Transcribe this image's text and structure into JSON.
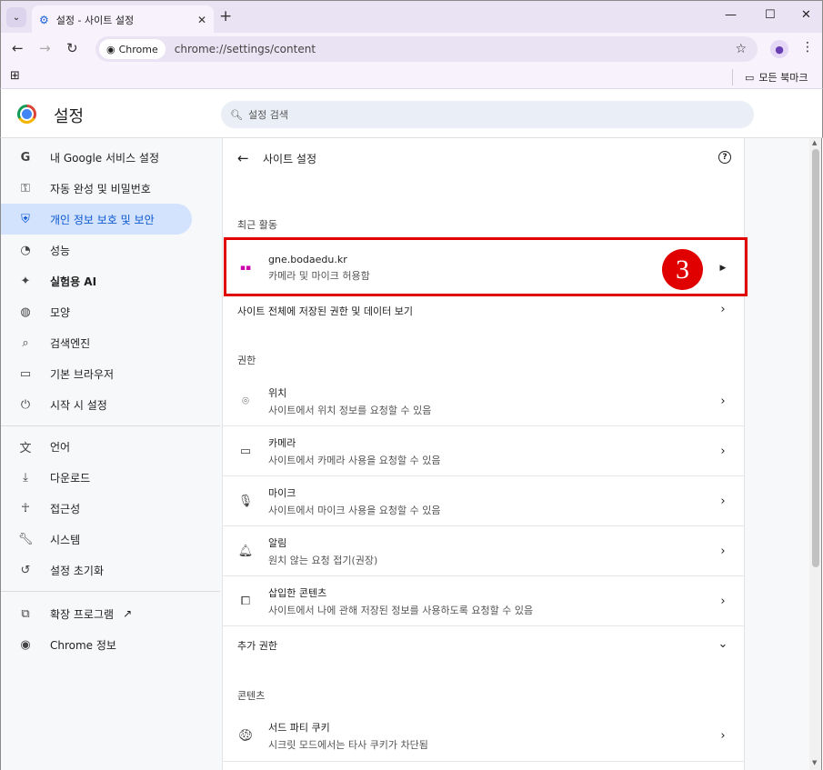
{
  "browser": {
    "tab_title": "설정 - 사이트 설정",
    "chip_label": "Chrome",
    "url": "chrome://settings/content",
    "bookmarks_all": "모든 북마크"
  },
  "header": {
    "title": "설정",
    "search_placeholder": "설정 검색"
  },
  "sidebar": {
    "items": [
      {
        "icon": "google-g-icon",
        "label": "내 Google 서비스 설정"
      },
      {
        "icon": "key-icon",
        "label": "자동 완성 및 비밀번호"
      },
      {
        "icon": "shield-icon",
        "label": "개인 정보 보호 및 보안"
      },
      {
        "icon": "speedometer-icon",
        "label": "성능"
      },
      {
        "icon": "sparkle-icon",
        "label": "실험용 AI"
      },
      {
        "icon": "palette-icon",
        "label": "모양"
      },
      {
        "icon": "search-icon",
        "label": "검색엔진"
      },
      {
        "icon": "browser-window-icon",
        "label": "기본 브라우저"
      },
      {
        "icon": "power-icon",
        "label": "시작 시 설정"
      },
      {
        "icon": "translate-icon",
        "label": "언어"
      },
      {
        "icon": "download-icon",
        "label": "다운로드"
      },
      {
        "icon": "accessibility-icon",
        "label": "접근성"
      },
      {
        "icon": "wrench-icon",
        "label": "시스템"
      },
      {
        "icon": "reset-icon",
        "label": "설정 초기화"
      },
      {
        "icon": "puzzle-icon",
        "label": "확장 프로그램"
      },
      {
        "icon": "chrome-icon",
        "label": "Chrome 정보"
      }
    ],
    "active_index": 2
  },
  "content": {
    "title": "사이트 설정",
    "recent_heading": "최근 활동",
    "recent_site": {
      "name": "gne.bodaedu.kr",
      "detail": "카메라 및 마이크 허용함"
    },
    "all_sites_label": "사이트 전체에 저장된 권한 및 데이터 보기",
    "permissions_heading": "권한",
    "permissions": [
      {
        "icon": "location-icon",
        "title": "위치",
        "subtitle": "사이트에서 위치 정보를 요청할 수 있음"
      },
      {
        "icon": "camera-icon",
        "title": "카메라",
        "subtitle": "사이트에서 카메라 사용을 요청할 수 있음"
      },
      {
        "icon": "microphone-icon",
        "title": "마이크",
        "subtitle": "사이트에서 마이크 사용을 요청할 수 있음"
      },
      {
        "icon": "bell-icon",
        "title": "알림",
        "subtitle": "원치 않는 요청 접기(권장)"
      },
      {
        "icon": "embedded-content-icon",
        "title": "삽입한 콘텐츠",
        "subtitle": "사이트에서 나에 관해 저장된 정보를 사용하도록 요청할 수 있음"
      }
    ],
    "more_permissions": "추가 권한",
    "content_heading": "콘텐츠",
    "content_items": [
      {
        "icon": "cookie-icon",
        "title": "서드 파티 쿠키",
        "subtitle": "시크릿 모드에서는 타사 쿠키가 차단됨"
      }
    ]
  },
  "annotation": {
    "step_number": "3",
    "color": "#e00000"
  }
}
